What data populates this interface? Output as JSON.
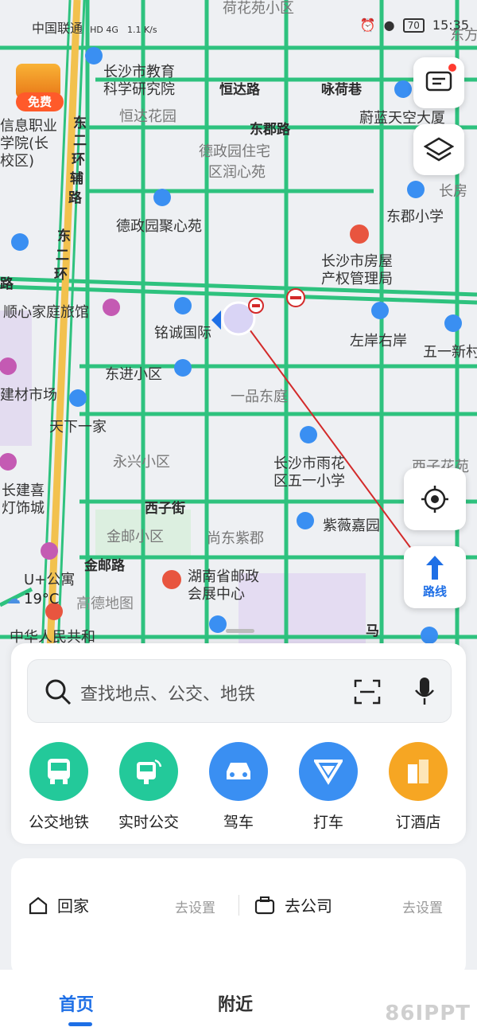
{
  "status_bar": {
    "carrier": "中国联通",
    "signal_icons": "HD 4G",
    "net_speed": "1.1 K/s",
    "battery": "70",
    "time": "15:35"
  },
  "map": {
    "labels": {
      "top1": "荷花苑小区",
      "top2": "东方",
      "jiaoyu1": "长沙市教育",
      "jiaoyu2": "科学研究院",
      "hengda_road": "恒达路",
      "yonghe_lane": "咏荷巷",
      "weilan": "蔚蓝天空大厦",
      "hengda_garden": "恒达花园",
      "dongjun_road": "东郡路",
      "dezheng1": "德政园住宅",
      "dezheng2": "区润心苑",
      "xinxi1": "信息职业",
      "xinxi2": "学院(长",
      "xinxi3": "校区)",
      "dongerhuan_aux1": "东",
      "dongerhuan_aux2": "二",
      "dongerhuan_aux3": "环",
      "dongerhuan_aux4": "辅",
      "dongerhuan_aux5": "路",
      "changfang": "长房",
      "dongjun_school": "东郡小学",
      "dezheng_jx": "德政园聚心苑",
      "dongerhuan1": "东",
      "dongerhuan2": "二",
      "dongerhuan3": "环",
      "fangchan1": "长沙市房屋",
      "fangchan2": "产权管理局",
      "lu": "路",
      "shunxin": "顺心家庭旅馆",
      "mingcheng": "铭诚国际",
      "zuoan": "左岸右岸",
      "wuyi": "五一新村",
      "dongjin": "东进小区",
      "jiancai": "建材市场",
      "yipin": "一品东庭",
      "tianxia": "天下一家",
      "yonghing": "永兴小区",
      "yuhua1": "长沙市雨花",
      "yuhua2": "区五一小学",
      "xizihua": "西子花苑",
      "changjian1": "长建喜",
      "changjian2": "灯饰城",
      "xizi_st": "西子街",
      "jinyou": "金邮小区",
      "shangdong": "尚东紫郡",
      "ziwei": "紫薇嘉园",
      "jinyou_road": "金邮路",
      "youzheng1": "湖南省邮政",
      "youzheng2": "会展中心",
      "ugongyu": "U+公寓",
      "zhonghua": "中华人民共和",
      "ma": "马"
    },
    "weather": "19°C",
    "brand": "高德地图",
    "promo": "免费",
    "route_button": "路线",
    "colors": {
      "road": "#2ec27e",
      "arterial": "#f2c14e",
      "accent": "#1e6fe6"
    }
  },
  "search": {
    "placeholder": "查找地点、公交、地铁"
  },
  "quick_actions": [
    {
      "label": "公交地铁",
      "color": "#23c99a",
      "icon": "bus-icon"
    },
    {
      "label": "实时公交",
      "color": "#23c99a",
      "icon": "realtime-bus-icon"
    },
    {
      "label": "驾车",
      "color": "#3a8ff2",
      "icon": "car-icon"
    },
    {
      "label": "打车",
      "color": "#3a8ff2",
      "icon": "taxi-icon"
    },
    {
      "label": "订酒店",
      "color": "#f6a623",
      "icon": "hotel-icon"
    }
  ],
  "shortcuts": {
    "home": "回家",
    "home_set": "去设置",
    "company": "去公司",
    "company_set": "去设置"
  },
  "tabs": {
    "home": "首页",
    "nearby": "附近"
  },
  "watermark": "86IPPT"
}
